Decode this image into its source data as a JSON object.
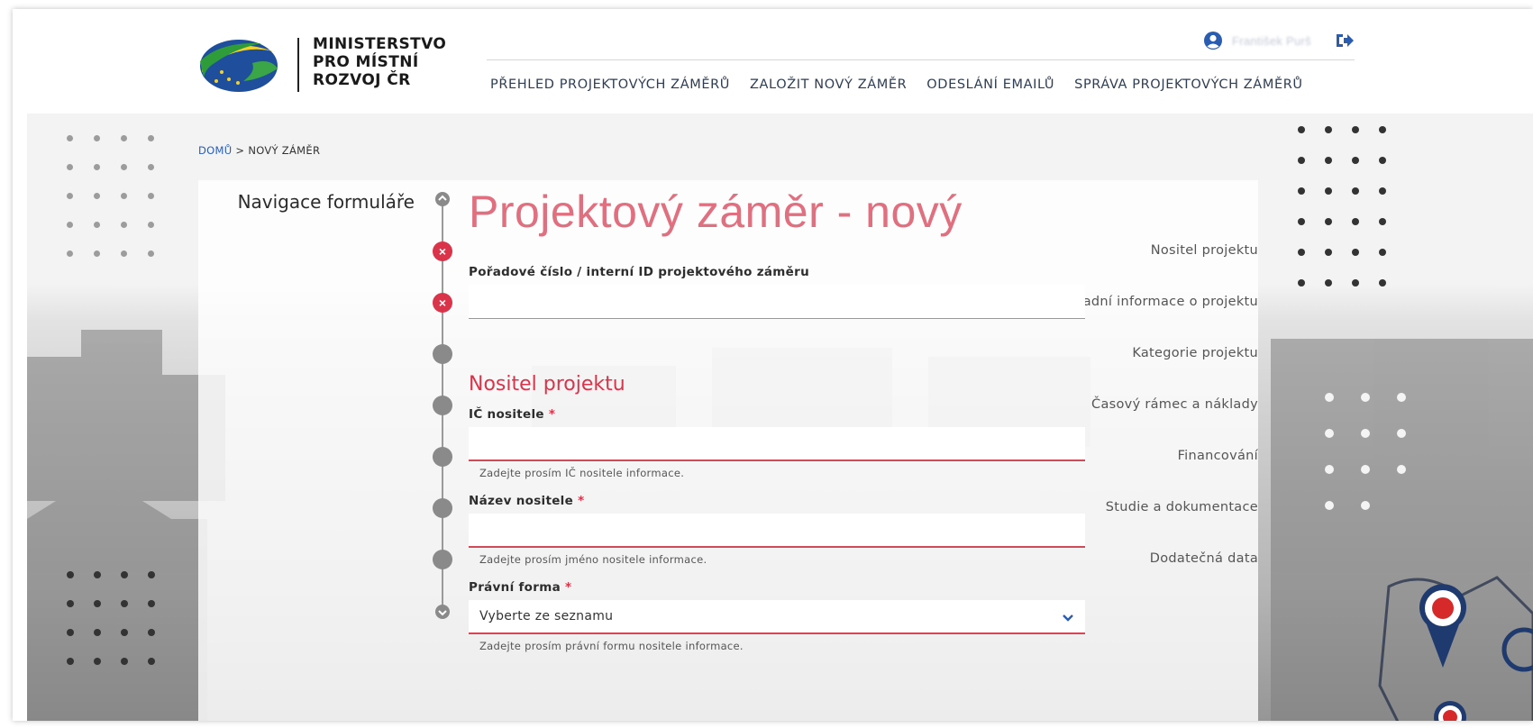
{
  "header": {
    "logo_lines": [
      "MINISTERSTVO",
      "PRO MÍSTNÍ",
      "ROZVOJ ČR"
    ],
    "user_name": "František Purš",
    "nav": [
      {
        "label": "PŘEHLED PROJEKTOVÝCH ZÁMĚRŮ"
      },
      {
        "label": "ZALOŽIT NOVÝ ZÁMĚR"
      },
      {
        "label": "ODESLÁNÍ EMAILŮ"
      },
      {
        "label": "SPRÁVA PROJEKTOVÝCH ZÁMĚRŮ"
      }
    ],
    "user_icon": "user-circle-icon",
    "logout_icon": "sign-out-icon"
  },
  "breadcrumb": {
    "home": "DOMŮ",
    "separator": " > ",
    "current": "NOVÝ ZÁMĚR"
  },
  "sidebar": {
    "title": "Navigace formuláře",
    "items": [
      {
        "label": "Nositel projektu",
        "status": "error"
      },
      {
        "label": "Základní informace o projektu",
        "status": "error"
      },
      {
        "label": "Kategorie projektu",
        "status": "default"
      },
      {
        "label": "Časový rámec a náklady",
        "status": "default"
      },
      {
        "label": "Financování",
        "status": "default"
      },
      {
        "label": "Studie a dokumentace",
        "status": "default"
      },
      {
        "label": "Dodatečná data",
        "status": "default"
      }
    ]
  },
  "form": {
    "title": "Projektový záměr - nový",
    "internal_id": {
      "label": "Pořadové číslo / interní ID projektového záměru",
      "value": ""
    },
    "section_title": "Nositel projektu",
    "ic": {
      "label": "IČ nositele",
      "required_mark": "*",
      "value": "",
      "help": "Zadejte prosím IČ nositele informace."
    },
    "name": {
      "label": "Název nositele",
      "required_mark": "*",
      "value": "",
      "help": "Zadejte prosím jméno nositele informace."
    },
    "legal_form": {
      "label": "Právní forma",
      "required_mark": "*",
      "selected": "Vyberte ze seznamu",
      "help": "Zadejte prosím právní formu nositele informace."
    }
  },
  "colors": {
    "accent": "#d9344a",
    "title": "#e06f7f",
    "nav_text": "#2f3d52",
    "link": "#2a5db0"
  }
}
